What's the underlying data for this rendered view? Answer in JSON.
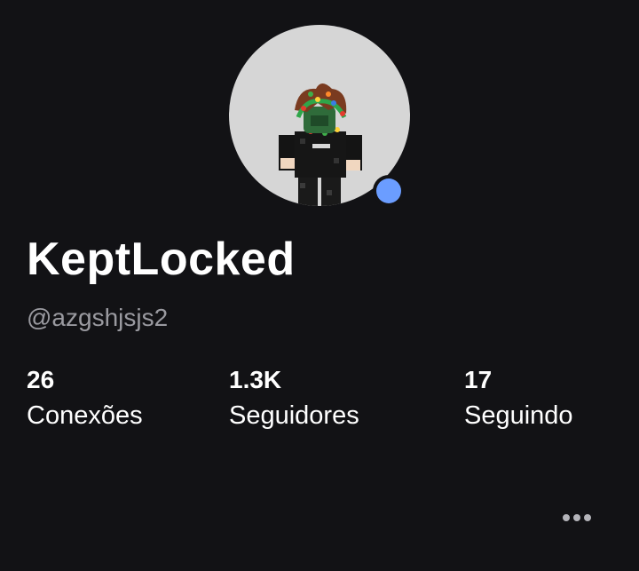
{
  "profile": {
    "display_name": "KeptLocked",
    "username": "@azgshjsjs2",
    "presence_color": "#6b9dff",
    "avatar_background": "#d6d6d6"
  },
  "stats": {
    "connections": {
      "value": "26",
      "label": "Conexões"
    },
    "followers": {
      "value": "1.3K",
      "label": "Seguidores"
    },
    "following": {
      "value": "17",
      "label": "Seguindo"
    }
  },
  "actions": {
    "more_icon": "more-horizontal-icon"
  },
  "theme": {
    "background": "#121215",
    "text_primary": "#ffffff",
    "text_secondary": "#9a9aa0"
  }
}
